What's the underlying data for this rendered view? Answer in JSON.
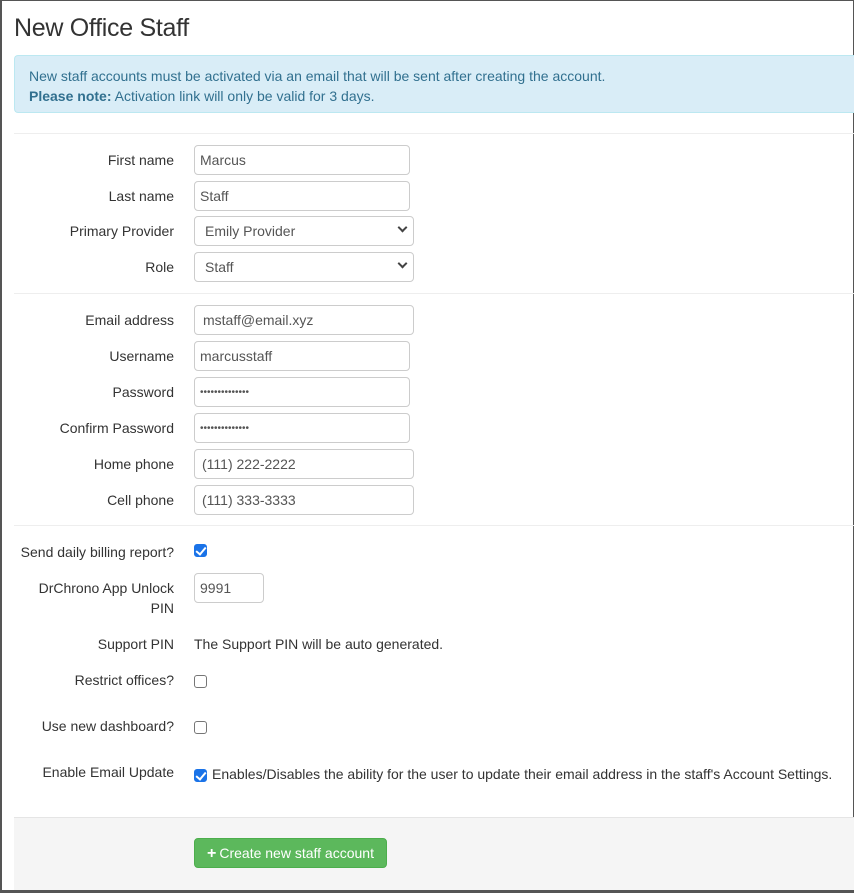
{
  "page": {
    "title": "New Office Staff"
  },
  "alert": {
    "line1": "New staff accounts must be activated via an email that will be sent after creating the account.",
    "note_label": "Please note:",
    "note_text": " Activation link will only be valid for 3 days."
  },
  "form": {
    "first_name": {
      "label": "First name",
      "value": "Marcus"
    },
    "last_name": {
      "label": "Last name",
      "value": "Staff"
    },
    "primary_provider": {
      "label": "Primary Provider",
      "selected": "Emily Provider"
    },
    "role": {
      "label": "Role",
      "selected": "Staff"
    },
    "email": {
      "label": "Email address",
      "value": "mstaff@email.xyz"
    },
    "username": {
      "label": "Username",
      "value": "marcusstaff"
    },
    "password": {
      "label": "Password",
      "value": "••••••••••••••"
    },
    "confirm_password": {
      "label": "Confirm Password",
      "value": "••••••••••••••"
    },
    "home_phone": {
      "label": "Home phone",
      "value": "(111) 222-2222"
    },
    "cell_phone": {
      "label": "Cell phone",
      "value": "(111) 333-3333"
    },
    "daily_billing": {
      "label": "Send daily billing report?",
      "checked": true
    },
    "unlock_pin": {
      "label": "DrChrono App Unlock PIN",
      "value": "9991"
    },
    "support_pin": {
      "label": "Support PIN",
      "text": "The Support PIN will be auto generated."
    },
    "restrict_offices": {
      "label": "Restrict offices?",
      "checked": false
    },
    "new_dashboard": {
      "label": "Use new dashboard?",
      "checked": false
    },
    "email_update": {
      "label": "Enable Email Update",
      "checked": true,
      "help": "Enables/Disables the ability for the user to update their email address in the staff's Account Settings."
    }
  },
  "footer": {
    "submit_icon": "plus-icon",
    "submit_label": "Create new staff account"
  }
}
